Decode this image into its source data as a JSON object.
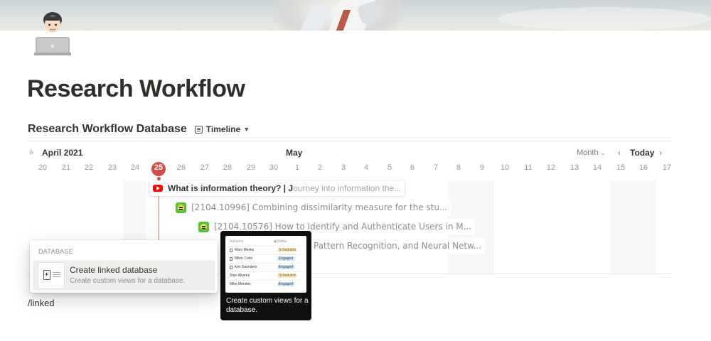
{
  "page": {
    "title": "Research Workflow",
    "icon": "technologist-emoji"
  },
  "database": {
    "title": "Research Workflow Database",
    "view_label": "Timeline",
    "view_icon": "list-view-icon"
  },
  "timeline": {
    "month_left": "April 2021",
    "month_right": "May",
    "scale_label": "Month",
    "today_label": "Today",
    "days": [
      "20",
      "21",
      "22",
      "23",
      "24",
      "25",
      "26",
      "27",
      "28",
      "29",
      "30",
      "1",
      "2",
      "3",
      "4",
      "5",
      "6",
      "7",
      "8",
      "9",
      "10",
      "11",
      "12",
      "13",
      "14",
      "15",
      "16",
      "17"
    ],
    "items": [
      {
        "icon": "youtube-icon",
        "title_strong": "What is information theory? | J",
        "title_faded": "ourney into information the..."
      },
      {
        "icon": "arxiv-icon",
        "title": "[2104.10996] Combining dissimilarity measure for the stu..."
      },
      {
        "icon": "arxiv-icon",
        "title": "[2104.10576] How to Identify and Authenticate Users in M..."
      },
      {
        "title": "Pattern Recognition, and Neural Netw..."
      }
    ]
  },
  "menu": {
    "section": "DATABASE",
    "item_title": "Create linked database",
    "item_desc": "Create custom views for a database."
  },
  "preview": {
    "head_name": "Name",
    "head_status": "Status",
    "rows": [
      {
        "name": "Mary Meeks",
        "status": "Scheduled"
      },
      {
        "name": "Mitch Cohn",
        "status": "Engaged"
      },
      {
        "name": "Kim Saunders",
        "status": "Engaged"
      },
      {
        "name": "Stan Alvarez",
        "status": "Scheduled"
      },
      {
        "name": "Mike Mendez",
        "status": "Engaged"
      }
    ],
    "caption": "Create custom views for a database."
  },
  "editor": {
    "typed_text": "/linked"
  },
  "colors": {
    "today_marker": "#d44c47",
    "scheduled_tag": "#fbecc5",
    "engaged_tag": "#d3e5ef"
  }
}
